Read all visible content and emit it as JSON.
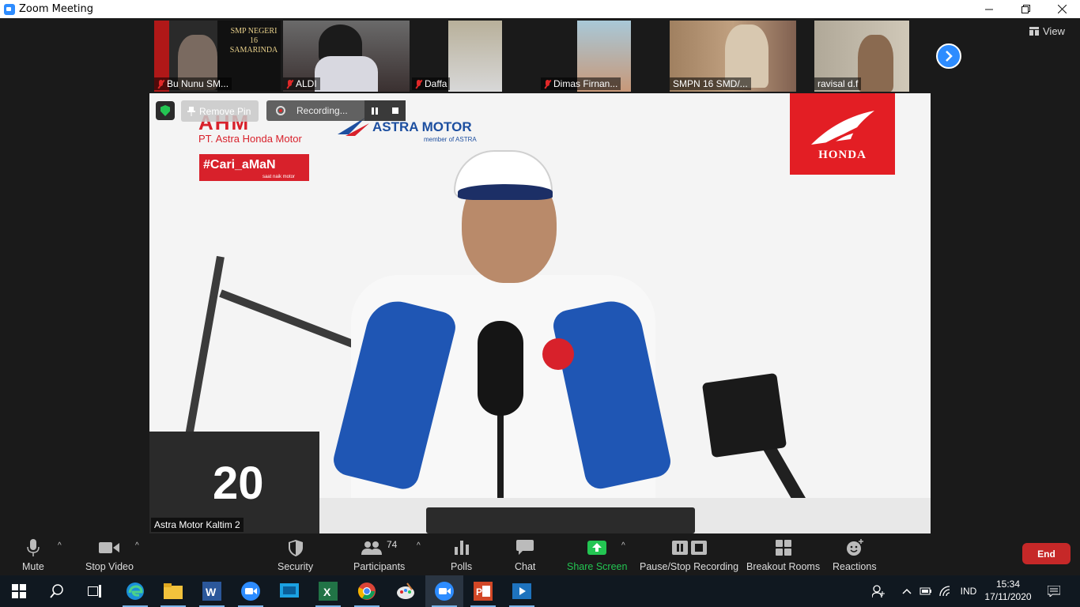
{
  "window": {
    "title": "Zoom Meeting",
    "controls": [
      "minimize",
      "restore",
      "close"
    ]
  },
  "thumbnails": [
    {
      "name": "Bu Nunu SM...",
      "muted": true,
      "overlay_text": "SMP NEGERI 16 SAMARINDA"
    },
    {
      "name": "ALDI",
      "muted": true
    },
    {
      "name": "Daffa",
      "muted": true
    },
    {
      "name": "Dimas Firnan...",
      "muted": true
    },
    {
      "name": "SMPN 16 SMD/...",
      "muted": false
    },
    {
      "name": "ravisal d.f",
      "muted": false
    }
  ],
  "view_button": "View",
  "main_video": {
    "participant_name": "Astra Motor Kaltim 2",
    "remove_pin_label": "Remove Pin",
    "recording_label": "Recording...",
    "logos": {
      "ahm": "AHM",
      "ahm_sub": "PT. Astra Honda Motor",
      "astra": "ASTRA MOTOR",
      "astra_sub": "member of ASTRA",
      "cari_aman": "#Cari_aMaN",
      "cari_aman_sub": "saat naik motor",
      "honda": "HONDA"
    },
    "calendar_number": "20"
  },
  "toolbar": {
    "mute": "Mute",
    "stop_video": "Stop Video",
    "security": "Security",
    "participants": "Participants",
    "participants_count": "74",
    "polls": "Polls",
    "chat": "Chat",
    "share_screen": "Share Screen",
    "pause_stop_recording": "Pause/Stop Recording",
    "breakout_rooms": "Breakout Rooms",
    "reactions": "Reactions",
    "end": "End"
  },
  "taskbar": {
    "apps": [
      "start-icon",
      "search-icon",
      "task-view-icon",
      "edge-icon",
      "file-explorer-icon",
      "word-icon",
      "zoom-icon",
      "remote-desktop-icon",
      "excel-icon",
      "chrome-icon",
      "paint-icon",
      "zoom-active-icon",
      "powerpoint-icon",
      "media-icon"
    ],
    "language": "IND",
    "time": "15:34",
    "date": "17/11/2020"
  },
  "colors": {
    "zoom_blue": "#2d8cff",
    "end_red": "#c62828",
    "honda_red": "#e31e24",
    "share_green": "#23c552",
    "muted_red": "#e02828"
  }
}
